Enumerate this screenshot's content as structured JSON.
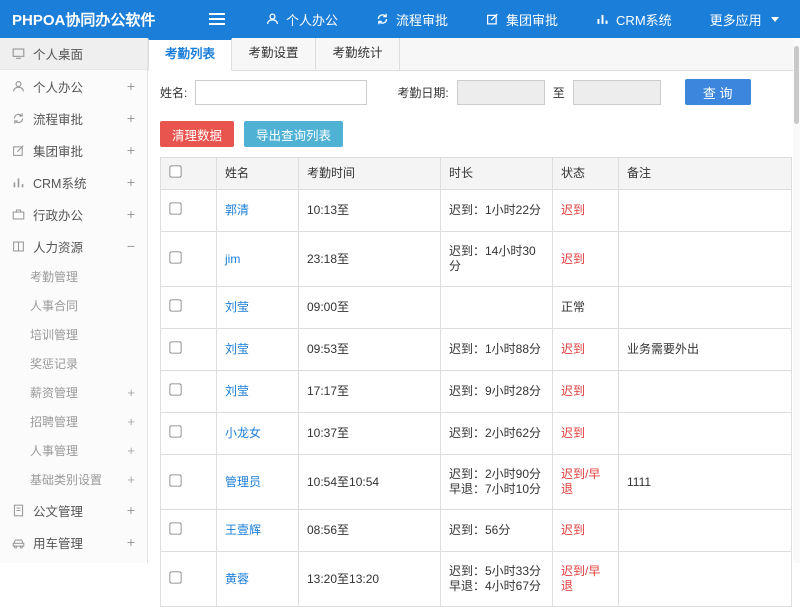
{
  "topbar": {
    "title": "PHPOA协同办公软件",
    "nav": [
      {
        "label": "个人办公"
      },
      {
        "label": "流程审批"
      },
      {
        "label": "集团审批"
      },
      {
        "label": "CRM系统"
      },
      {
        "label": "更多应用"
      }
    ]
  },
  "sidebar": {
    "items": [
      {
        "label": "个人桌面",
        "suffix": ""
      },
      {
        "label": "个人办公",
        "suffix": "+"
      },
      {
        "label": "流程审批",
        "suffix": "+"
      },
      {
        "label": "集团审批",
        "suffix": "+"
      },
      {
        "label": "CRM系统",
        "suffix": "+"
      },
      {
        "label": "行政办公",
        "suffix": "+"
      },
      {
        "label": "人力资源",
        "suffix": "−"
      },
      {
        "label": "公文管理",
        "suffix": "+"
      },
      {
        "label": "用车管理",
        "suffix": "+"
      }
    ],
    "hr_subitems": [
      {
        "label": "考勤管理",
        "suffix": ""
      },
      {
        "label": "人事合同",
        "suffix": ""
      },
      {
        "label": "培训管理",
        "suffix": ""
      },
      {
        "label": "奖惩记录",
        "suffix": ""
      },
      {
        "label": "薪资管理",
        "suffix": "+"
      },
      {
        "label": "招聘管理",
        "suffix": "+"
      },
      {
        "label": "人事管理",
        "suffix": "+"
      },
      {
        "label": "基础类别设置",
        "suffix": "+"
      }
    ]
  },
  "tabs": [
    {
      "label": "考勤列表"
    },
    {
      "label": "考勤设置"
    },
    {
      "label": "考勤统计"
    }
  ],
  "filter": {
    "name_label": "姓名:",
    "date_label": "考勤日期:",
    "to_label": "至",
    "search_button": "查 询"
  },
  "actions": {
    "clean_button": "清理数据",
    "export_button": "导出查询列表"
  },
  "table": {
    "headers": {
      "name": "姓名",
      "time": "考勤时间",
      "duration": "时长",
      "status": "状态",
      "note": "备注"
    },
    "rows": [
      {
        "name": "郭清",
        "time": "10:13至",
        "duration": "迟到：1小时22分",
        "status": "迟到",
        "status_color": "#e03c3c",
        "note": ""
      },
      {
        "name": "jim",
        "time": "23:18至",
        "duration": "迟到：14小时30分",
        "status": "迟到",
        "status_color": "#e03c3c",
        "note": ""
      },
      {
        "name": "刘莹",
        "time": "09:00至",
        "duration": "",
        "status": "正常",
        "status_color": "#333333",
        "note": ""
      },
      {
        "name": "刘莹",
        "time": "09:53至",
        "duration": "迟到：1小时88分",
        "status": "迟到",
        "status_color": "#e03c3c",
        "note": "业务需要外出"
      },
      {
        "name": "刘莹",
        "time": "17:17至",
        "duration": "迟到：9小时28分",
        "status": "迟到",
        "status_color": "#e03c3c",
        "note": ""
      },
      {
        "name": "小龙女",
        "time": "10:37至",
        "duration": "迟到：2小时62分",
        "status": "迟到",
        "status_color": "#e03c3c",
        "note": ""
      },
      {
        "name": "管理员",
        "time": "10:54至10:54",
        "duration": "迟到：2小时90分\n早退：7小时10分",
        "status": "迟到/早退",
        "status_color": "#e03c3c",
        "note": "1111"
      },
      {
        "name": "王壹辉",
        "time": "08:56至",
        "duration": "迟到：56分",
        "status": "迟到",
        "status_color": "#e03c3c",
        "note": ""
      },
      {
        "name": "黄蓉",
        "time": "13:20至13:20",
        "duration": "迟到：5小时33分\n早退：4小时67分",
        "status": "迟到/早退",
        "status_color": "#e03c3c",
        "note": ""
      }
    ]
  },
  "colors": {
    "topbar": "#1b7ed9",
    "link": "#1b7ed9",
    "late": "#e03c3c"
  }
}
